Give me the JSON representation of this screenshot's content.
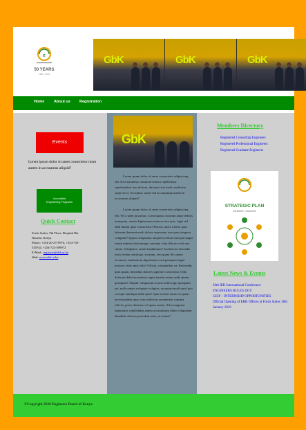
{
  "header": {
    "logo_caption": "50 YEARS",
    "logo_sub": "1969 - 2019",
    "photo_text": "GbK"
  },
  "nav": {
    "items": [
      "Home",
      "About us",
      "Registration"
    ]
  },
  "left": {
    "events_label": "Events",
    "events_text": "Lorem ipsum dolor sit amet consectetur nium autem in accusamus aliquid?",
    "accredited_line1": "Accredited",
    "accredited_line2": "Engineering Programs",
    "quick_contact_title": "Quick Contact",
    "contact": {
      "line1": "Fortis Suites, 9th Floor, Hospital Rd,",
      "line2": "Nairobi, Kenya",
      "line3": "Phone: +254-20-2719974, +254-735-",
      "line4": "330744, +254-722-509972",
      "email_label": "E-Mail :",
      "email": "registrar@ebk.or.ke",
      "web_label": "Web:",
      "web": "www.ebk.or.ke"
    }
  },
  "middle": {
    "para1": "Lorem ipsum dolor sit amet consectetur adipisicing elit. Necessitatibus commodi tenetur repellendus reprehenderit rem dolores, ducimus sint modi, molestias saepe sit et. Excepturi, saepe sed accusantium autem in accusamus aliquid?",
    "para2": "Lorem ipsum dolor sit amet consectetur adipisicing elit. Vel a unde possimus. Consequatur, nostrum atque debitis numquam, omnis dignissimos maiores iure quis, fugit sed nihil harum quos consectetur? Placeat, amet. Libero quas laborum deserunt modi dolore aspernatur iure quos tempora voluptate? Ipsum voluptatem aliquid at officia suscipit magni rerum minima doloremque, maxime vitae dolores velit non soluta. Voluptates, omnis laudantium? Architecto reiciendis iusto tenetur similique, nostrum, rem quam illo autem inventore, laudantium dignissimos sed quisquam fugiat maiores vitae amet odio? Officia, voluptatibus ea. Reiciendis quas ipsam, doloribus dolores sapiente consectetur. Odio dolorum delectus minima fugiat tenetur minus unde ipsam quisquam! Aliquid voluptatum sit non nobis fugit quisquam aut, nulla omnis voluptate voluptas, excepturi modi quod quo corrupti similique nihil optio! Quia eveniet natus excepturi necessitatibus quas cum molestias assumenda, minima officiis, porro ducimus vel quam autem. Alias magnam aspernatur, repellendus autem accusantium illum voluptatem blanditiis dolores provident iusto, at earum?"
  },
  "right": {
    "members_title": "Members Directory",
    "members": [
      "Registered Consulting Engineers",
      "Registered Professional Engineers",
      "Registered Graduate Engineers"
    ],
    "strategic_title": "STRATEGIC PLAN",
    "strategic_sub": "2018/2019 - 2022/2023",
    "news_title": "Latest News & Events",
    "news": [
      "26th IEK International Conference",
      "ENGINEERS RULES 2019",
      "GEIP – INTERNSHIP OPPORTUNITIES",
      "Official Opening of EBK Offices at Fortis Suites 18th January 2019"
    ]
  },
  "footer": {
    "copyright": "©Copyright 2020 Engineers Board of Kenya"
  },
  "colors": {
    "outer": "#ffa000",
    "nav": "#008a00",
    "footer": "#33cc33",
    "accent_green": "#33cc33",
    "events_red": "#ee0000",
    "middle_column": "#78909c",
    "link": "#0000ee"
  }
}
